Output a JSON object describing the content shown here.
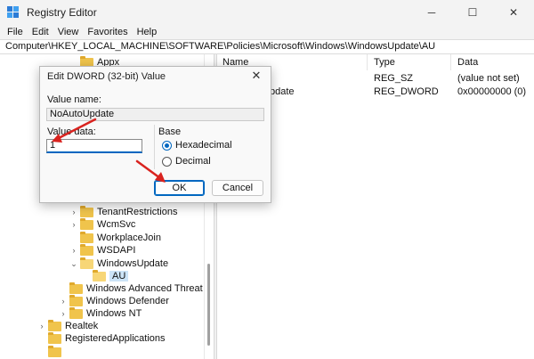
{
  "window": {
    "title": "Registry Editor"
  },
  "controls": {
    "minimize": "─",
    "maximize": "☐",
    "close": "✕"
  },
  "menu": [
    "File",
    "Edit",
    "View",
    "Favorites",
    "Help"
  ],
  "address": "Computer\\HKEY_LOCAL_MACHINE\\SOFTWARE\\Policies\\Microsoft\\Windows\\WindowsUpdate\\AU",
  "tree": {
    "items": [
      {
        "label": "Appx",
        "chevron": ""
      },
      {
        "label": "TenantRestrictions",
        "chevron": "›"
      },
      {
        "label": "WcmSvc",
        "chevron": "›"
      },
      {
        "label": "WorkplaceJoin",
        "chevron": ""
      },
      {
        "label": "WSDAPI",
        "chevron": "›"
      },
      {
        "label": "WindowsUpdate",
        "chevron": "⌄"
      },
      {
        "label": "AU",
        "chevron": ""
      },
      {
        "label": "Windows Advanced Threat Prot",
        "chevron": ""
      },
      {
        "label": "Windows Defender",
        "chevron": "›"
      },
      {
        "label": "Windows NT",
        "chevron": "›"
      },
      {
        "label": "Realtek",
        "chevron": "›"
      },
      {
        "label": "RegisteredApplications",
        "chevron": ""
      },
      {
        "label": "",
        "chevron": ""
      }
    ]
  },
  "list": {
    "headers": {
      "name": "Name",
      "type": "Type",
      "data": "Data"
    },
    "rows": [
      {
        "name": "",
        "type": "REG_SZ",
        "data": "(value not set)"
      },
      {
        "name": "pdate",
        "type": "REG_DWORD",
        "data": "0x00000000 (0)"
      }
    ]
  },
  "dialog": {
    "title": "Edit DWORD (32-bit) Value",
    "close": "✕",
    "value_name_label": "Value name:",
    "value_name": "NoAutoUpdate",
    "value_data_label": "Value data:",
    "value_data": "1",
    "base_label": "Base",
    "hex_label": "Hexadecimal",
    "dec_label": "Decimal",
    "base_selected": "Hexadecimal",
    "ok_label": "OK",
    "cancel_label": "Cancel"
  },
  "colors": {
    "accent": "#0067c0",
    "annotation_arrow": "#d9231f",
    "folder": "#f0c44c"
  }
}
